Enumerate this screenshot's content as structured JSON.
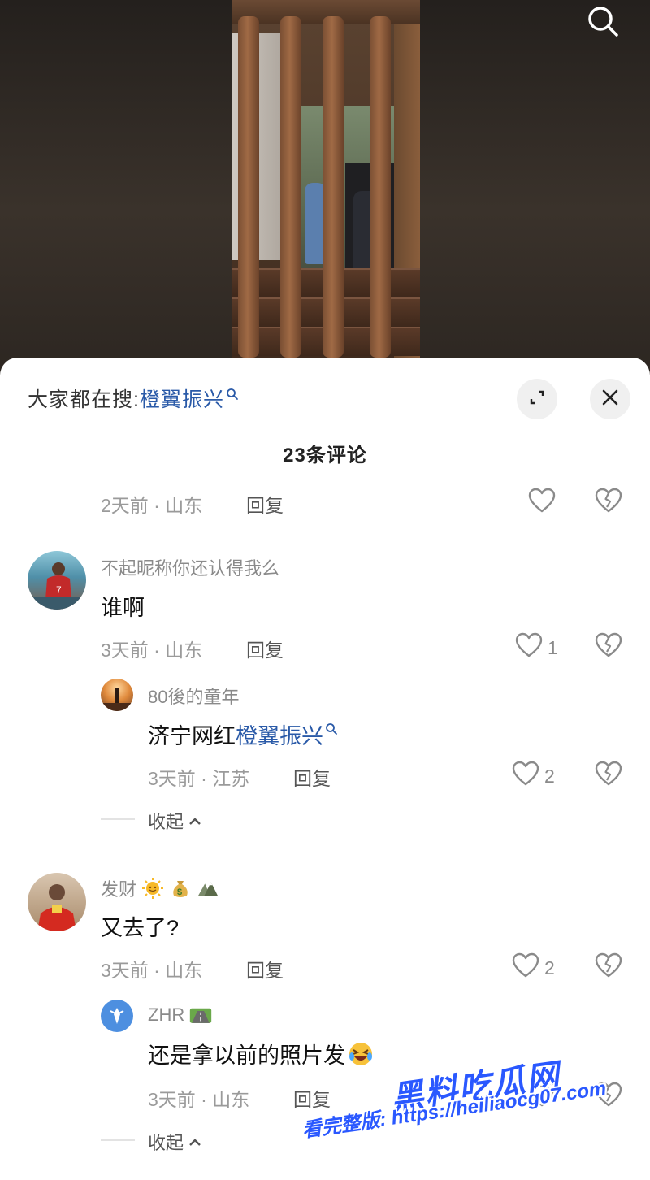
{
  "search_hint": {
    "prefix": "大家都在搜:",
    "keyword": "橙翼振兴"
  },
  "comment_count": "23条评论",
  "comments": [
    {
      "partial": true,
      "meta": "2天前 · 山东",
      "reply_label": "回复"
    },
    {
      "username": "不起昵称你还认得我么",
      "text": "谁啊",
      "meta": "3天前 · 山东",
      "reply_label": "回复",
      "likes": "1",
      "replies": [
        {
          "username": "80後的童年",
          "text_prefix": "济宁网红",
          "text_link": "橙翼振兴",
          "meta": "3天前 · 江苏",
          "reply_label": "回复",
          "likes": "2"
        }
      ],
      "collapse_label": "收起"
    },
    {
      "username": "发财",
      "username_emojis": [
        "sun-emoji",
        "money-bag-emoji",
        "mountain-emoji"
      ],
      "text": "又去了?",
      "meta": "3天前 · 山东",
      "reply_label": "回复",
      "likes": "2",
      "replies": [
        {
          "username": "ZHR",
          "username_emojis": [
            "road-emoji"
          ],
          "text": "还是拿以前的照片发",
          "text_emoji": "rolling-laughing-emoji",
          "meta": "3天前 · 山东",
          "reply_label": "回复"
        }
      ],
      "collapse_label": "收起"
    }
  ],
  "watermark": {
    "brand": "黑料吃瓜网",
    "line2": "看完整版: https://heiliaocg07.com"
  },
  "colors": {
    "link": "#2a5aa8",
    "watermark": "#2a58ff"
  }
}
